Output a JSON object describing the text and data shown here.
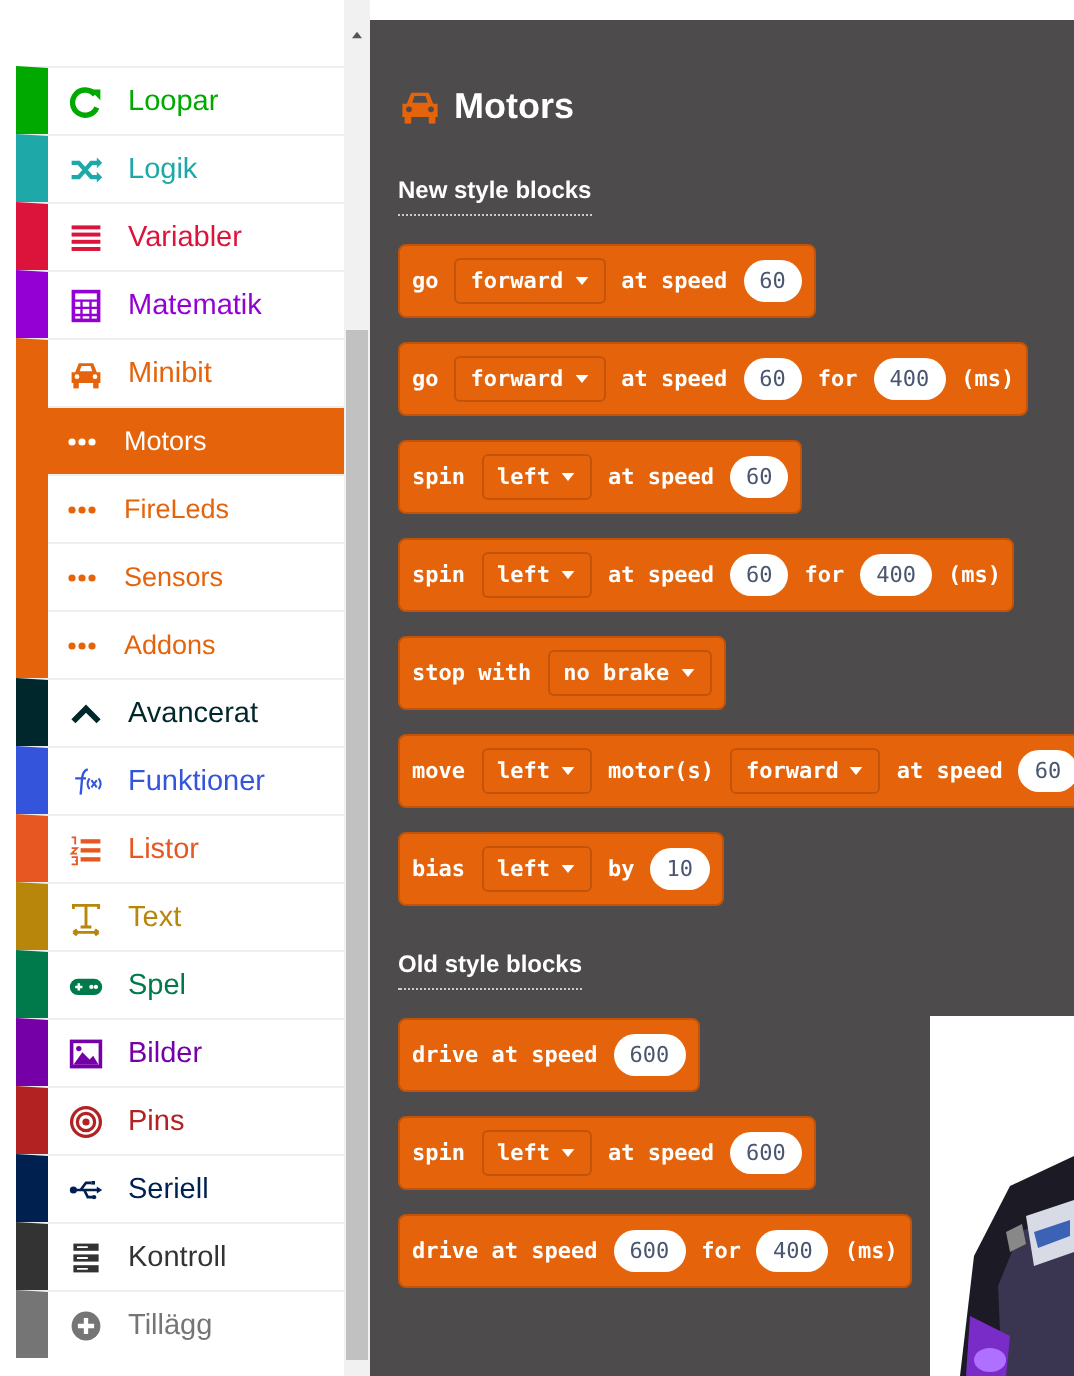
{
  "categories": [
    {
      "label": "Loopar",
      "color": "#00a900",
      "selected": false
    },
    {
      "label": "Logik",
      "color": "#1ea8a8",
      "selected": false
    },
    {
      "label": "Variabler",
      "color": "#dc143c",
      "selected": false
    },
    {
      "label": "Matematik",
      "color": "#9400d3",
      "selected": false
    },
    {
      "label": "Minibit",
      "color": "#e5640b",
      "selected": false,
      "expanded": true,
      "children": [
        {
          "label": "Motors",
          "selected": true
        },
        {
          "label": "FireLeds",
          "selected": false
        },
        {
          "label": "Sensors",
          "selected": false
        },
        {
          "label": "Addons",
          "selected": false
        }
      ]
    },
    {
      "label": "Avancerat",
      "color": "#00272b",
      "selected": false
    },
    {
      "label": "Funktioner",
      "color": "#3455db",
      "selected": false
    },
    {
      "label": "Listor",
      "color": "#e65722",
      "selected": false
    },
    {
      "label": "Text",
      "color": "#b8860b",
      "selected": false
    },
    {
      "label": "Spel",
      "color": "#007a4b",
      "selected": false
    },
    {
      "label": "Bilder",
      "color": "#7600a8",
      "selected": false
    },
    {
      "label": "Pins",
      "color": "#b22222",
      "selected": false
    },
    {
      "label": "Seriell",
      "color": "#002050",
      "selected": false
    },
    {
      "label": "Kontroll",
      "color": "#333333",
      "selected": false
    },
    {
      "label": "Tillägg",
      "color": "#757575",
      "selected": false
    }
  ],
  "flyout": {
    "title": "Motors",
    "sections": [
      {
        "label": "New style blocks",
        "blocks": [
          [
            {
              "kind": "text",
              "text": "go"
            },
            {
              "kind": "dropdown",
              "text": "forward"
            },
            {
              "kind": "text",
              "text": "at speed"
            },
            {
              "kind": "number",
              "text": "60"
            }
          ],
          [
            {
              "kind": "text",
              "text": "go"
            },
            {
              "kind": "dropdown",
              "text": "forward"
            },
            {
              "kind": "text",
              "text": "at speed"
            },
            {
              "kind": "number",
              "text": "60"
            },
            {
              "kind": "text",
              "text": "for"
            },
            {
              "kind": "number",
              "text": "400"
            },
            {
              "kind": "text",
              "text": "(ms)"
            }
          ],
          [
            {
              "kind": "text",
              "text": "spin"
            },
            {
              "kind": "dropdown",
              "text": "left"
            },
            {
              "kind": "text",
              "text": "at speed"
            },
            {
              "kind": "number",
              "text": "60"
            }
          ],
          [
            {
              "kind": "text",
              "text": "spin"
            },
            {
              "kind": "dropdown",
              "text": "left"
            },
            {
              "kind": "text",
              "text": "at speed"
            },
            {
              "kind": "number",
              "text": "60"
            },
            {
              "kind": "text",
              "text": "for"
            },
            {
              "kind": "number",
              "text": "400"
            },
            {
              "kind": "text",
              "text": "(ms)"
            }
          ],
          [
            {
              "kind": "text",
              "text": "stop with"
            },
            {
              "kind": "dropdown",
              "text": "no brake"
            }
          ],
          [
            {
              "kind": "text",
              "text": "move"
            },
            {
              "kind": "dropdown",
              "text": "left"
            },
            {
              "kind": "text",
              "text": "motor(s)"
            },
            {
              "kind": "dropdown",
              "text": "forward"
            },
            {
              "kind": "text",
              "text": "at speed"
            },
            {
              "kind": "number",
              "text": "60"
            }
          ],
          [
            {
              "kind": "text",
              "text": "bias"
            },
            {
              "kind": "dropdown",
              "text": "left"
            },
            {
              "kind": "text",
              "text": "by"
            },
            {
              "kind": "number",
              "text": "10"
            }
          ]
        ]
      },
      {
        "label": "Old style blocks",
        "blocks": [
          [
            {
              "kind": "text",
              "text": "drive at speed"
            },
            {
              "kind": "number",
              "text": "600"
            }
          ],
          [
            {
              "kind": "text",
              "text": "spin"
            },
            {
              "kind": "dropdown",
              "text": "left"
            },
            {
              "kind": "text",
              "text": "at speed"
            },
            {
              "kind": "number",
              "text": "600"
            }
          ],
          [
            {
              "kind": "text",
              "text": "drive at speed"
            },
            {
              "kind": "number",
              "text": "600"
            },
            {
              "kind": "text",
              "text": "for"
            },
            {
              "kind": "number",
              "text": "400"
            },
            {
              "kind": "text",
              "text": "(ms)"
            }
          ]
        ]
      }
    ]
  }
}
